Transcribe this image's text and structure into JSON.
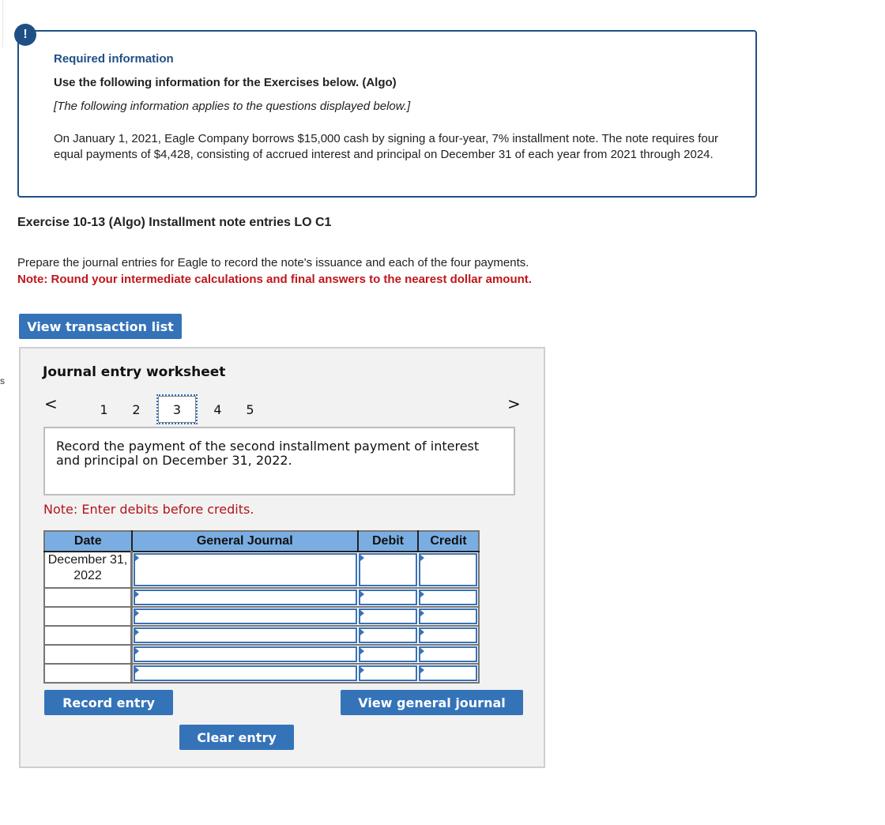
{
  "required_info": {
    "badge": "!",
    "title": "Required information",
    "subtitle": "Use the following information for the Exercises below. (Algo)",
    "italic_note": "[The following information applies to the questions displayed below.]",
    "body": "On January 1, 2021, Eagle Company borrows $15,000 cash by signing a four-year, 7% installment note. The note requires four equal payments of $4,428, consisting of accrued interest and principal on December 31 of each year from 2021 through 2024."
  },
  "exercise": {
    "title": "Exercise 10-13 (Algo) Installment note entries LO C1",
    "instructions": "Prepare the journal entries for Eagle to record the note's issuance and each of the four payments.",
    "note": "Note: Round your intermediate calculations and final answers to the nearest dollar amount."
  },
  "side_mark": "s",
  "buttons": {
    "view_transaction_list": "View transaction list",
    "record_entry": "Record entry",
    "view_general_journal": "View general journal",
    "clear_entry": "Clear entry"
  },
  "worksheet": {
    "title": "Journal entry worksheet",
    "prev_icon": "<",
    "next_icon": ">",
    "steps": [
      "1",
      "2",
      "3",
      "4",
      "5"
    ],
    "active_step": "3",
    "prompt": "Record the payment of the second installment payment of interest and principal on December 31, 2022.",
    "note": "Note: Enter debits before credits.",
    "table": {
      "headers": [
        "Date",
        "General Journal",
        "Debit",
        "Credit"
      ],
      "rows": [
        {
          "date": "December 31, 2022",
          "general_journal": "",
          "debit": "",
          "credit": ""
        },
        {
          "date": "",
          "general_journal": "",
          "debit": "",
          "credit": ""
        },
        {
          "date": "",
          "general_journal": "",
          "debit": "",
          "credit": ""
        },
        {
          "date": "",
          "general_journal": "",
          "debit": "",
          "credit": ""
        },
        {
          "date": "",
          "general_journal": "",
          "debit": "",
          "credit": ""
        },
        {
          "date": "",
          "general_journal": "",
          "debit": "",
          "credit": ""
        }
      ]
    }
  },
  "colors": {
    "brand_blue": "#1f4f85",
    "button_blue": "#3573b9",
    "header_blue": "#7aaee3",
    "note_red": "#c0161b"
  }
}
